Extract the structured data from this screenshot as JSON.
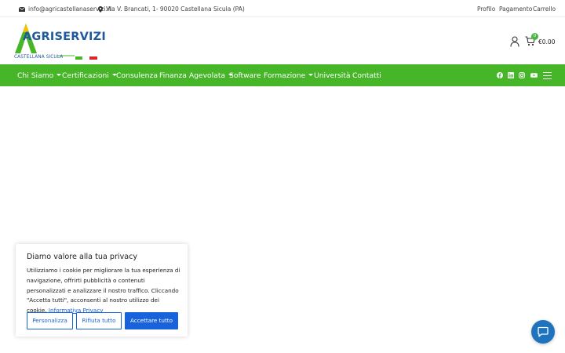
{
  "topbar": {
    "email": "info@agricastellanaservizi.it",
    "address": "Via V. Brancati, 1- 90020 Castellana Sicula (PA)",
    "links": [
      "Profilo",
      "Pagamento",
      "Carrello"
    ]
  },
  "header": {
    "logo_word": "AGRISERVIZI",
    "logo_sub": "CASTELLANA SICULA",
    "cart_count": "0",
    "cart_total": "€0.00"
  },
  "nav": {
    "items": [
      {
        "label": "Chi Siamo",
        "dropdown": true
      },
      {
        "label": "Certificazioni",
        "dropdown": true
      },
      {
        "label": "Consulenza",
        "dropdown": false
      },
      {
        "label": "Finanza Agevolata",
        "dropdown": true
      },
      {
        "label": "Software",
        "dropdown": false
      },
      {
        "label": "Formazione",
        "dropdown": true
      },
      {
        "label": "Università",
        "dropdown": false
      },
      {
        "label": "Contatti",
        "dropdown": false
      }
    ],
    "social_icons": [
      "facebook-icon",
      "linkedin-icon",
      "instagram-icon",
      "youtube-icon"
    ]
  },
  "cookie": {
    "title": "Diamo valore alla tua privacy",
    "body": "Utilizziamo i cookie per migliorare la tua esperienza di navigazione, offrirti pubblicità o contenuti personalizzati e analizzare il nostro traffico. Cliccando \"Accetta tutti\", acconsenti al nostro utilizzo dei cookie.",
    "link": "Informativa Privacy",
    "btn_customize": "Personalizza",
    "btn_reject": "Rifiuta tutto",
    "btn_accept": "Accettare tutto"
  },
  "colors": {
    "nav_green": "#47b528",
    "cookie_blue": "#1863dc",
    "chat_blue": "#1e73be",
    "logo_blue": "#1f5a9c"
  }
}
